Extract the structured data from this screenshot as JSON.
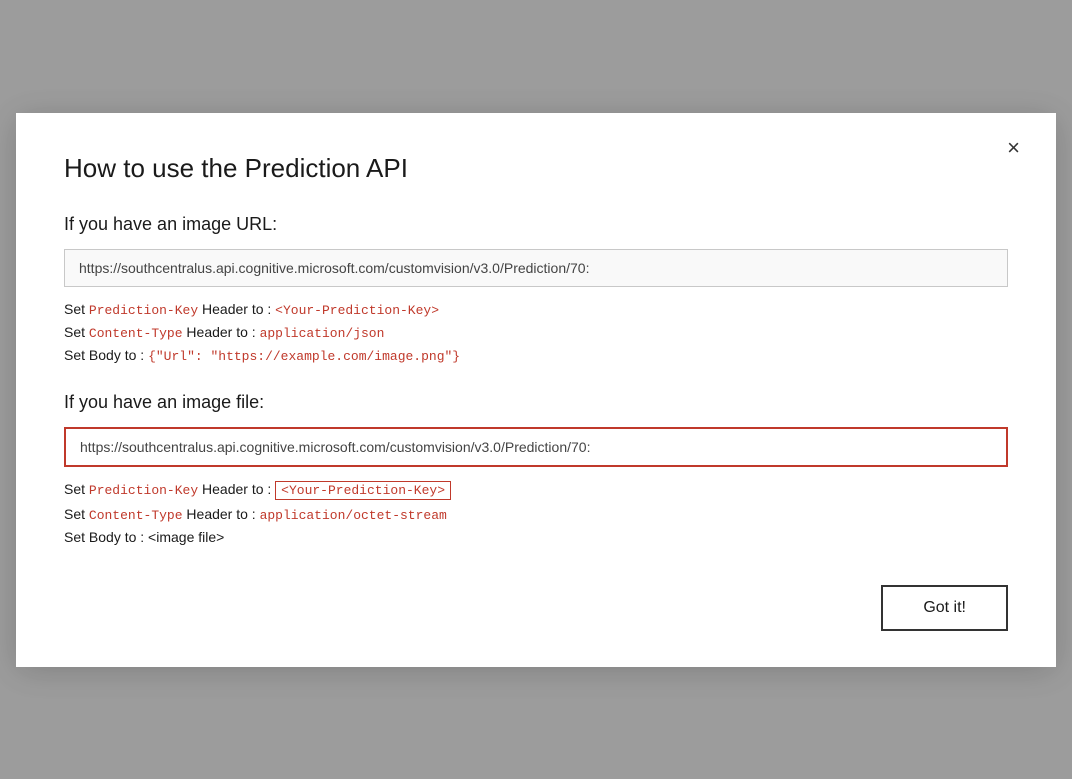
{
  "dialog": {
    "title": "How to use the Prediction API",
    "close_label": "×"
  },
  "section_url": {
    "heading": "If you have an image URL:",
    "url": "https://southcentralus.api.cognitive.microsoft.com/customvision/v3.0/Prediction/70:",
    "lines": [
      {
        "prefix": "Set ",
        "key": "Prediction-Key",
        "middle": " Header to : ",
        "value": "<Your-Prediction-Key>",
        "value_boxed": false
      },
      {
        "prefix": "Set ",
        "key": "Content-Type",
        "middle": " Header to : ",
        "value": "application/json",
        "value_boxed": false
      },
      {
        "prefix": "Set Body to : ",
        "key": "",
        "middle": "",
        "value": "{\"Url\": \"https://example.com/image.png\"}",
        "value_boxed": false
      }
    ]
  },
  "section_file": {
    "heading": "If you have an image file:",
    "url": "https://southcentralus.api.cognitive.microsoft.com/customvision/v3.0/Prediction/70:",
    "lines": [
      {
        "prefix": "Set ",
        "key": "Prediction-Key",
        "middle": " Header to : ",
        "value": "<Your-Prediction-Key>",
        "value_boxed": true
      },
      {
        "prefix": "Set ",
        "key": "Content-Type",
        "middle": " Header to : ",
        "value": "application/octet-stream",
        "value_boxed": false
      },
      {
        "prefix": "Set Body to : <image file>",
        "key": "",
        "middle": "",
        "value": "",
        "value_boxed": false
      }
    ]
  },
  "footer": {
    "got_it_label": "Got it!"
  }
}
